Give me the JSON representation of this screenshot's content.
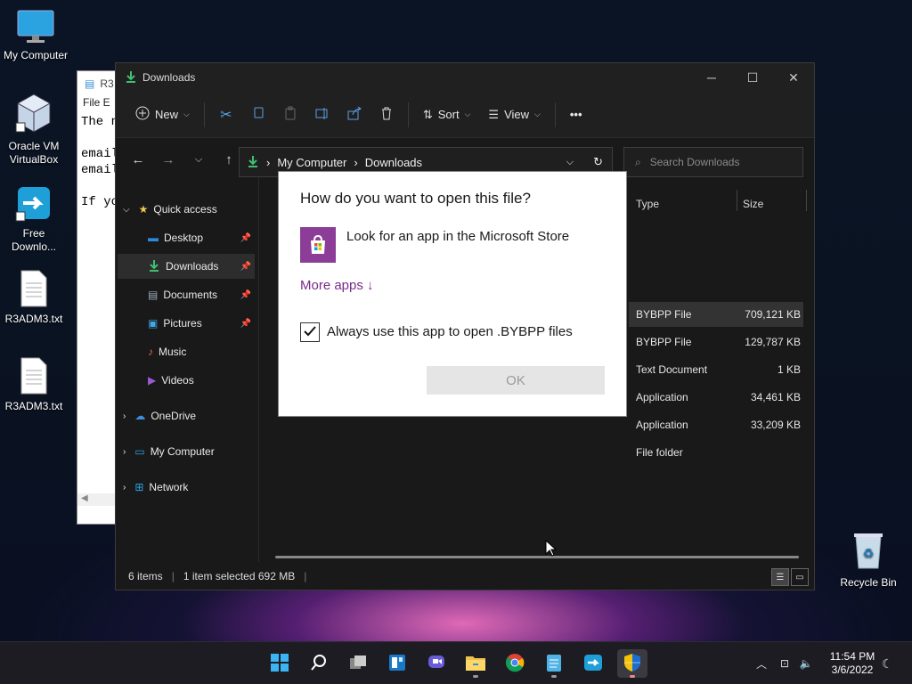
{
  "desktop": {
    "icons": [
      {
        "label": "My Computer"
      },
      {
        "label": "Oracle VM VirtualBox"
      },
      {
        "label": "Free Downlo..."
      },
      {
        "label": "R3ADM3.txt"
      },
      {
        "label": "R3ADM3.txt"
      },
      {
        "label": "Recycle Bin"
      }
    ]
  },
  "notepad": {
    "title": "R3",
    "menu": "File   E",
    "lines": [
      "The n",
      "",
      "email",
      "email",
      "",
      "If yo"
    ]
  },
  "explorer": {
    "title": "Downloads",
    "toolbar": {
      "new": "New",
      "sort": "Sort",
      "view": "View",
      "more": "•••"
    },
    "breadcrumb": {
      "root": "My Computer",
      "current": "Downloads"
    },
    "search_placeholder": "Search Downloads",
    "nav": {
      "quick_access": "Quick access",
      "desktop": "Desktop",
      "downloads": "Downloads",
      "documents": "Documents",
      "pictures": "Pictures",
      "music": "Music",
      "videos": "Videos",
      "onedrive": "OneDrive",
      "my_computer": "My Computer",
      "network": "Network"
    },
    "columns": {
      "type": "Type",
      "size": "Size"
    },
    "rows": [
      {
        "type": "BYBPP File",
        "size": "709,121 KB"
      },
      {
        "type": "BYBPP File",
        "size": "129,787 KB"
      },
      {
        "type": "Text Document",
        "size": "1 KB"
      },
      {
        "type": "Application",
        "size": "34,461 KB"
      },
      {
        "type": "Application",
        "size": "33,209 KB"
      },
      {
        "type": "File folder",
        "size": ""
      }
    ],
    "status": {
      "items": "6 items",
      "selected": "1 item selected  692 MB"
    }
  },
  "dialog": {
    "title": "How do you want to open this file?",
    "store_option": "Look for an app in the Microsoft Store",
    "more_apps": "More apps  ↓",
    "always_use": "Always use this app to open .BYBPP files",
    "always_use_checked": true,
    "ok": "OK"
  },
  "taskbar": {
    "time": "11:54 PM",
    "date": "3/6/2022"
  },
  "colors": {
    "accent_purple": "#7a2a8c",
    "store_bg": "#8b3d97",
    "explorer_bg": "#191919"
  }
}
